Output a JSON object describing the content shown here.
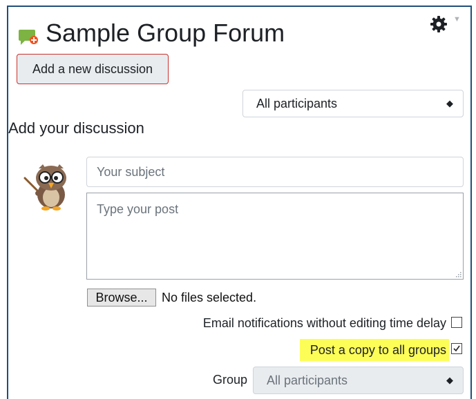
{
  "forum": {
    "title": "Sample Group Forum",
    "add_button_label": "Add a new discussion"
  },
  "group_filter": {
    "selected": "All participants",
    "arrows": "◆"
  },
  "discussion": {
    "section_title": "Add your discussion",
    "subject_placeholder": "Your subject",
    "post_placeholder": "Type your post",
    "browse_label": "Browse...",
    "no_files_text": "No files selected.",
    "email_label": "Email notifications without editing time delay",
    "email_checked": false,
    "copy_label": "Post a copy to all groups",
    "copy_checked": true,
    "group_label": "Group",
    "group_selected": "All participants"
  },
  "icons": {
    "forum": "forum-chat-icon",
    "gear": "gear-icon",
    "caret": "caret-down-icon",
    "avatar": "owl-teacher-avatar"
  },
  "colors": {
    "add_button_border": "#c9302c",
    "highlight": "#fdfd57",
    "frame_border": "#1f4e79"
  }
}
